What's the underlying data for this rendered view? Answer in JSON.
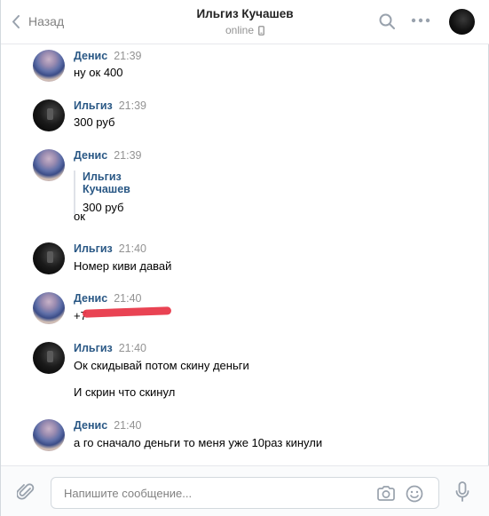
{
  "header": {
    "back_label": "Назад",
    "title": "Ильгиз Кучашев",
    "status": "online",
    "icons": [
      "back-chevron-icon",
      "search-icon",
      "more-icon",
      "avatar"
    ]
  },
  "messages": [
    {
      "author": "Денис",
      "time": "21:39",
      "lines": [
        "ну ок 400"
      ]
    },
    {
      "author": "Ильгиз",
      "time": "21:39",
      "lines": [
        "300 руб"
      ]
    },
    {
      "author": "Денис",
      "time": "21:39",
      "quote": {
        "author": "Ильгиз Кучашев",
        "text": "300 руб"
      },
      "lines": [
        "ок"
      ]
    },
    {
      "author": "Ильгиз",
      "time": "21:40",
      "lines": [
        "Номер киви давай"
      ]
    },
    {
      "author": "Денис",
      "time": "21:40",
      "lines": [
        "+7"
      ]
    },
    {
      "author": "Ильгиз",
      "time": "21:40",
      "lines": [
        "Ок скидывай потом скину деньги",
        "И скрин что скинул"
      ]
    },
    {
      "author": "Денис",
      "time": "21:40",
      "lines": [
        "а го сначало деньги то меня уже 10раз кинули"
      ]
    }
  ],
  "composer": {
    "placeholder": "Напишите сообщение...",
    "value": "",
    "icons": [
      "paperclip-icon",
      "camera-icon",
      "smiley-icon",
      "microphone-icon"
    ]
  },
  "colors": {
    "author": "#2a5885",
    "muted": "#939393",
    "border": "#d3d9de",
    "redaction": "#e8394a"
  }
}
